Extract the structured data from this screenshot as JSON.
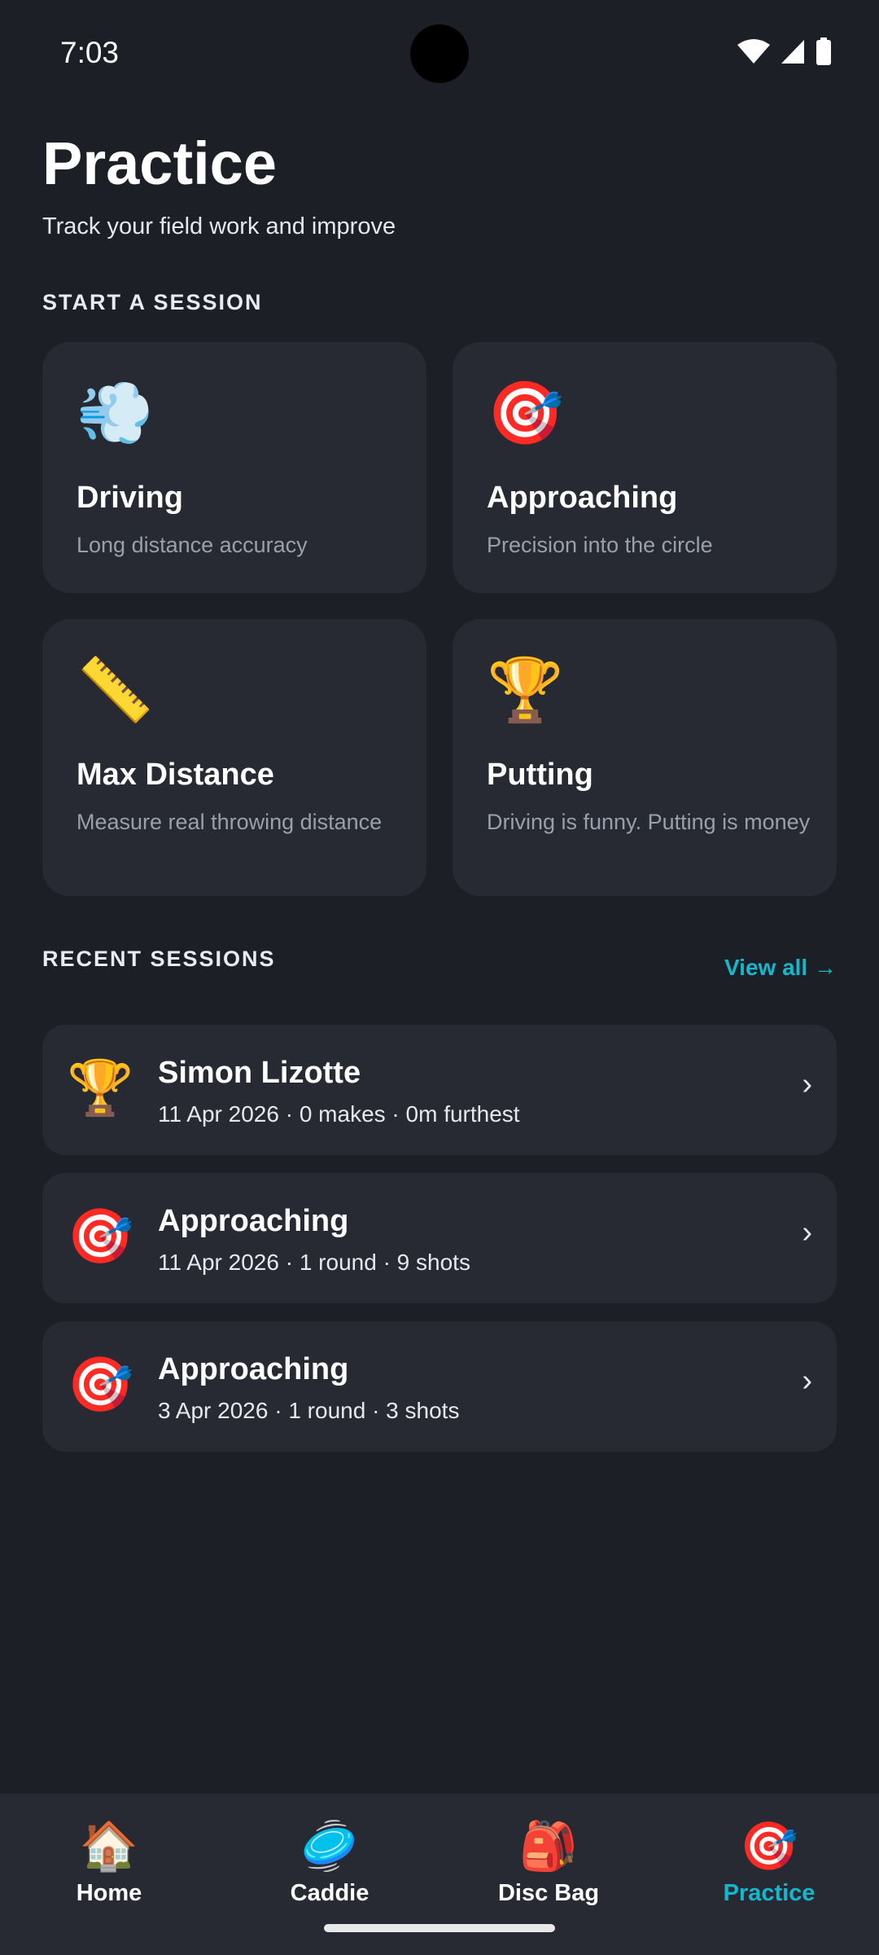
{
  "status_bar": {
    "time": "7:03"
  },
  "header": {
    "title": "Practice",
    "subtitle": "Track your field work and improve"
  },
  "start_section": {
    "label": "START A SESSION",
    "cards": [
      {
        "icon": "dashing-away-icon",
        "emoji": "💨",
        "title": "Driving",
        "desc": "Long distance accuracy"
      },
      {
        "icon": "direct-hit-icon",
        "emoji": "🎯",
        "title": "Approaching",
        "desc": "Precision into the circle"
      },
      {
        "icon": "ruler-icon",
        "emoji": "📏",
        "title": "Max Distance",
        "desc": "Measure real throwing distance"
      },
      {
        "icon": "trophy-icon",
        "emoji": "🏆",
        "title": "Putting",
        "desc": "Driving is funny. Putting is money"
      }
    ]
  },
  "recent_section": {
    "label": "RECENT SESSIONS",
    "view_all": "View all →",
    "sessions": [
      {
        "icon": "trophy-icon",
        "emoji": "🏆",
        "title": "Simon Lizotte",
        "meta": "11 Apr 2026 · 0 makes · 0m furthest",
        "chevron": "›"
      },
      {
        "icon": "direct-hit-icon",
        "emoji": "🎯",
        "title": "Approaching",
        "meta": "11 Apr 2026 · 1 round · 9 shots",
        "chevron": "›"
      },
      {
        "icon": "direct-hit-icon",
        "emoji": "🎯",
        "title": "Approaching",
        "meta": "3 Apr 2026 · 1 round · 3 shots",
        "chevron": "›"
      }
    ]
  },
  "bottom_nav": {
    "items": [
      {
        "icon": "house-icon",
        "emoji": "🏠",
        "label": "Home"
      },
      {
        "icon": "flying-disc-icon",
        "emoji": "🥏",
        "label": "Caddie"
      },
      {
        "icon": "backpack-icon",
        "emoji": "🎒",
        "label": "Disc Bag"
      },
      {
        "icon": "direct-hit-icon",
        "emoji": "🎯",
        "label": "Practice"
      }
    ],
    "active": "Practice"
  },
  "colors": {
    "background": "#1c1f26",
    "card": "#272a33",
    "accent": "#16b7cc",
    "muted_text": "#9aa0ab"
  }
}
